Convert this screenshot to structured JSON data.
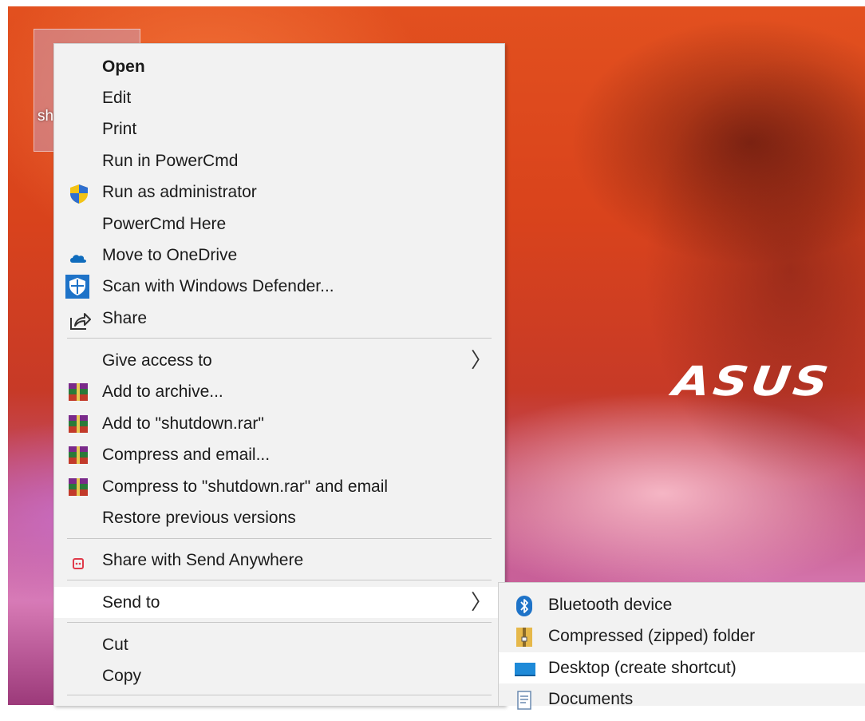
{
  "desktop": {
    "icon_label": "sh",
    "brand": "ASUS"
  },
  "context_menu": {
    "items": [
      {
        "label": "Open",
        "icon": "none"
      },
      {
        "label": "Edit",
        "icon": "none"
      },
      {
        "label": "Print",
        "icon": "none"
      },
      {
        "label": "Run in PowerCmd",
        "icon": "none"
      },
      {
        "label": "Run as administrator",
        "icon": "uac-shield-icon"
      },
      {
        "label": "PowerCmd Here",
        "icon": "none"
      },
      {
        "label": "Move to OneDrive",
        "icon": "onedrive-cloud-icon"
      },
      {
        "label": "Scan with Windows Defender...",
        "icon": "windows-defender-icon"
      },
      {
        "label": "Share",
        "icon": "share-icon"
      },
      {
        "label": "Give access to",
        "icon": "none"
      },
      {
        "label": "Add to archive...",
        "icon": "winrar-icon"
      },
      {
        "label": "Add to \"shutdown.rar\"",
        "icon": "winrar-icon"
      },
      {
        "label": "Compress and email...",
        "icon": "winrar-icon"
      },
      {
        "label": "Compress to \"shutdown.rar\" and email",
        "icon": "winrar-icon"
      },
      {
        "label": "Restore previous versions",
        "icon": "none"
      },
      {
        "label": "Share with Send Anywhere",
        "icon": "send-anywhere-icon"
      },
      {
        "label": "Send to",
        "icon": "none"
      },
      {
        "label": "Cut",
        "icon": "none"
      },
      {
        "label": "Copy",
        "icon": "none"
      }
    ]
  },
  "send_to_submenu": {
    "items": [
      {
        "label": "Bluetooth device",
        "icon": "bluetooth-icon"
      },
      {
        "label": "Compressed (zipped) folder",
        "icon": "zip-folder-icon"
      },
      {
        "label": "Desktop (create shortcut)",
        "icon": "desktop-icon"
      },
      {
        "label": "Documents",
        "icon": "documents-icon"
      }
    ]
  },
  "colors": {
    "menu_background": "#f2f2f2",
    "hover_background": "#ffffff",
    "text": "#1b1b1b",
    "onedrive_blue": "#0f6cbd",
    "defender_blue": "#1e73c8"
  }
}
